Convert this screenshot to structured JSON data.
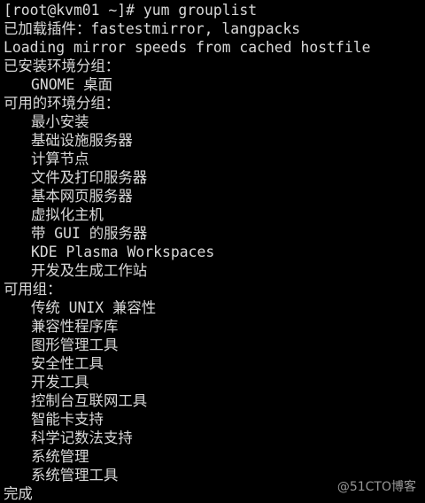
{
  "terminal": {
    "prompt": "[root@kvm01 ~]# yum grouplist",
    "plugins": "已加载插件：fastestmirror, langpacks",
    "loading": "Loading mirror speeds from cached hostfile",
    "installed_env_header": "已安装环境分组：",
    "installed_env_items": [
      "GNOME 桌面"
    ],
    "available_env_header": "可用的环境分组：",
    "available_env_items": [
      "最小安装",
      "基础设施服务器",
      "计算节点",
      "文件及打印服务器",
      "基本网页服务器",
      "虚拟化主机",
      "带 GUI 的服务器",
      "KDE Plasma Workspaces",
      "开发及生成工作站"
    ],
    "available_groups_header": "可用组：",
    "available_groups_items": [
      "传统 UNIX 兼容性",
      "兼容性程序库",
      "图形管理工具",
      "安全性工具",
      "开发工具",
      "控制台互联网工具",
      "智能卡支持",
      "科学记数法支持",
      "系统管理",
      "系统管理工具"
    ],
    "done": "完成"
  },
  "watermark": "@51CTO博客",
  "colors": {
    "background": "#000000",
    "text": "#d9d9d9"
  }
}
